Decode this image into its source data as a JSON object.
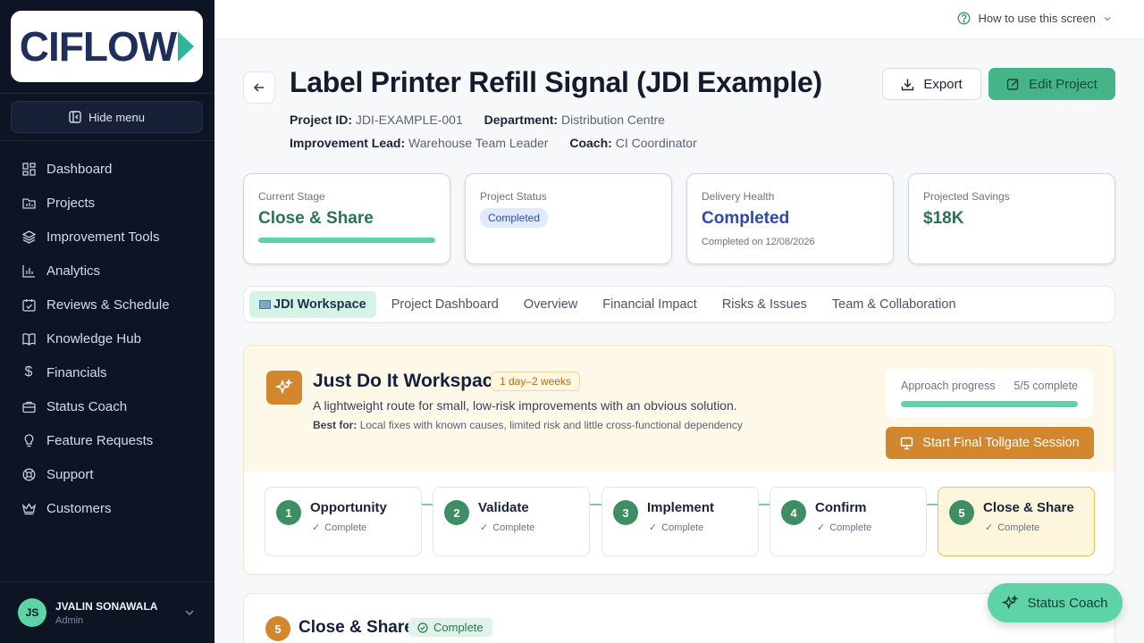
{
  "sidebar": {
    "logo": "CIFLOW",
    "hide_menu": "Hide menu",
    "items": [
      {
        "label": "Dashboard",
        "icon": "grid-icon"
      },
      {
        "label": "Projects",
        "icon": "folder-icon"
      },
      {
        "label": "Improvement Tools",
        "icon": "layers-icon"
      },
      {
        "label": "Analytics",
        "icon": "bar-chart-icon"
      },
      {
        "label": "Reviews & Schedule",
        "icon": "calendar-icon"
      },
      {
        "label": "Knowledge Hub",
        "icon": "book-icon"
      },
      {
        "label": "Financials",
        "icon": "dollar-icon"
      },
      {
        "label": "Status Coach",
        "icon": "briefcase-icon"
      },
      {
        "label": "Feature Requests",
        "icon": "lightbulb-icon"
      },
      {
        "label": "Support",
        "icon": "lifebuoy-icon"
      },
      {
        "label": "Customers",
        "icon": "crown-icon"
      }
    ],
    "user": {
      "initials": "JS",
      "name": "JVALIN SONAWALA",
      "role": "Admin"
    }
  },
  "topbar": {
    "help": "How to use this screen"
  },
  "header": {
    "title": "Label Printer Refill Signal (JDI Example)",
    "project_id_label": "Project ID:",
    "project_id": "JDI-EXAMPLE-001",
    "department_label": "Department:",
    "department": "Distribution Centre",
    "lead_label": "Improvement Lead:",
    "lead": "Warehouse Team Leader",
    "coach_label": "Coach:",
    "coach": "CI Coordinator",
    "export": "Export",
    "edit": "Edit Project"
  },
  "stats": {
    "stage": {
      "label": "Current Stage",
      "value": "Close & Share",
      "progress": 1.0
    },
    "status": {
      "label": "Project Status",
      "value": "Completed"
    },
    "health": {
      "label": "Delivery Health",
      "value": "Completed",
      "sub": "Completed on 12/08/2026"
    },
    "savings": {
      "label": "Projected Savings",
      "value": "$18K"
    }
  },
  "tabs": [
    {
      "label": "JDI Workspace",
      "active": true
    },
    {
      "label": "Project Dashboard",
      "active": false
    },
    {
      "label": "Overview",
      "active": false
    },
    {
      "label": "Financial Impact",
      "active": false
    },
    {
      "label": "Risks & Issues",
      "active": false
    },
    {
      "label": "Team & Collaboration",
      "active": false
    }
  ],
  "jdi": {
    "title": "Just Do It Workspace",
    "duration": "1 day–2 weeks",
    "description": "A lightweight route for small, low-risk improvements with an obvious solution.",
    "best_for_label": "Best for:",
    "best_for": "Local fixes with known causes, limited risk and little cross-functional dependency",
    "progress_label": "Approach progress",
    "progress_text": "5/5 complete",
    "progress_fraction": 1.0,
    "tollgate_button": "Start Final Tollgate Session",
    "steps": [
      {
        "num": "1",
        "name": "Opportunity",
        "status": "Complete"
      },
      {
        "num": "2",
        "name": "Validate",
        "status": "Complete"
      },
      {
        "num": "3",
        "name": "Implement",
        "status": "Complete"
      },
      {
        "num": "4",
        "name": "Confirm",
        "status": "Complete"
      },
      {
        "num": "5",
        "name": "Close & Share",
        "status": "Complete"
      }
    ]
  },
  "section": {
    "num": "5",
    "title": "Close & Share",
    "badge": "Complete"
  },
  "fab": {
    "label": "Status Coach"
  },
  "colors": {
    "sidebar_bg": "#0d1424",
    "accent_green": "#5fd3a8",
    "accent_orange": "#d2872f",
    "edit_button": "#46b489"
  }
}
